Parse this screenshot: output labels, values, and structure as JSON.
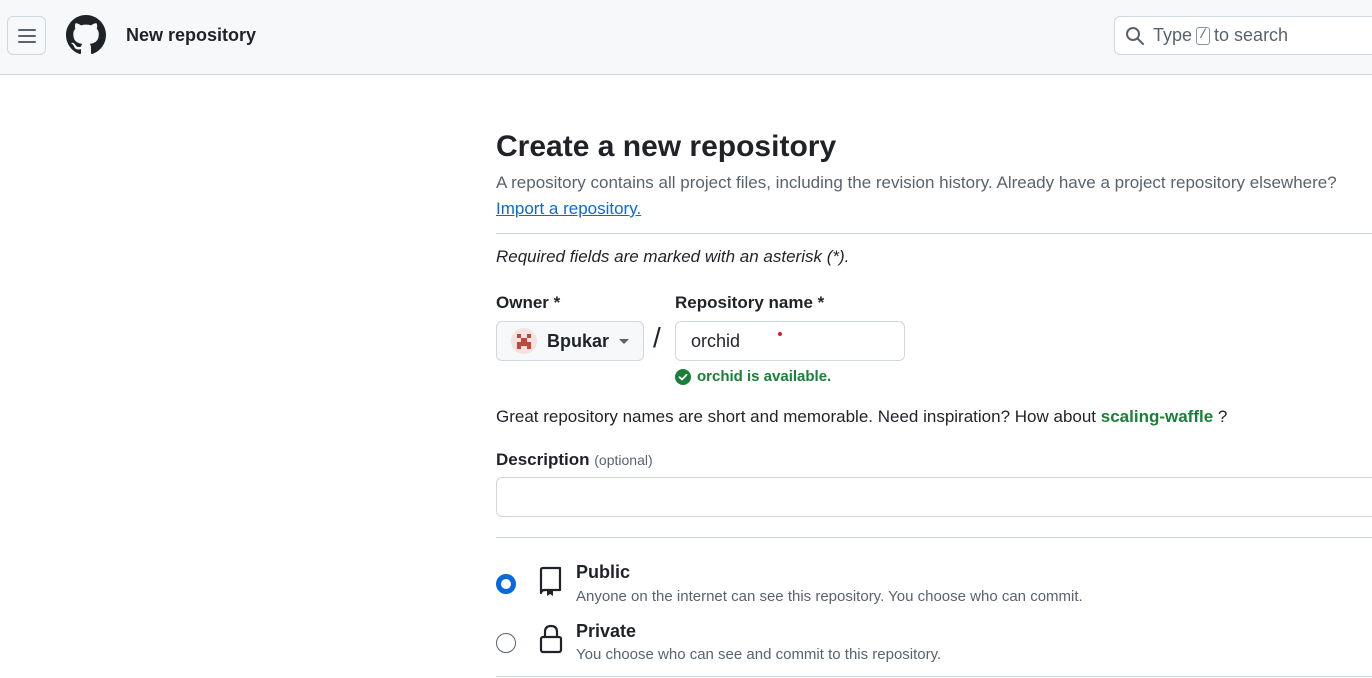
{
  "header": {
    "title": "New repository",
    "search": {
      "prefix": "Type",
      "key": "/",
      "suffix": "to search"
    }
  },
  "main": {
    "title": "Create a new repository",
    "description": "A repository contains all project files, including the revision history. Already have a project repository elsewhere?",
    "import_link": "Import a repository.",
    "required_note": "Required fields are marked with an asterisk (*).",
    "owner": {
      "label": "Owner *",
      "value": "Bpukar"
    },
    "separator": "/",
    "repo_name": {
      "label": "Repository name *",
      "value": "orchid"
    },
    "availability": "orchid is available.",
    "suggestion": {
      "text": "Great repository names are short and memorable. Need inspiration? How about",
      "name": "scaling-waffle",
      "end": "?"
    },
    "description_field": {
      "label": "Description",
      "optional": "(optional)",
      "value": ""
    },
    "visibility": [
      {
        "title": "Public",
        "desc": "Anyone on the internet can see this repository. You choose who can commit.",
        "selected": true,
        "icon": "repo-icon"
      },
      {
        "title": "Private",
        "desc": "You choose who can see and commit to this repository.",
        "selected": false,
        "icon": "lock-icon"
      }
    ]
  },
  "colors": {
    "accent": "#0969da",
    "success": "#1a7f37",
    "muted": "#59636e"
  }
}
